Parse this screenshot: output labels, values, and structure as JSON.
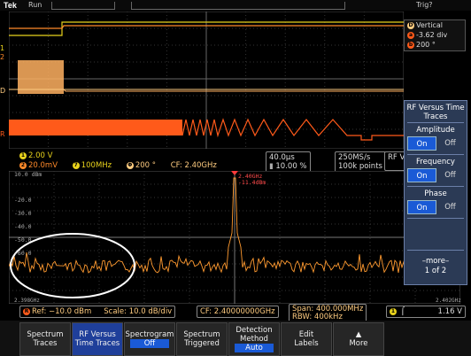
{
  "header": {
    "brand": "Tek",
    "run_state": "Run",
    "trigger_state": "Trig?"
  },
  "vertical_panel": {
    "title": "Vertical",
    "position": "-3.62 div",
    "angle": "200 °",
    "channel_label": "D"
  },
  "channel_markers": {
    "ch1": "1",
    "ch2": "2",
    "ch3": "3",
    "rf": "R"
  },
  "readouts": {
    "ch1_scale": "2.00 V",
    "ch2_scale": "20.0mV",
    "bw_label": "7",
    "bw": "100MHz",
    "phase_label": "Φ",
    "phase": "200 °",
    "cf_short": "CF: 2.40GHz",
    "timebase": "40.0µs",
    "duty": "10.00 %",
    "sample_rate": "250MS/s",
    "record_length": "100k points",
    "rf_label": "RF V"
  },
  "spectrum": {
    "top_scale": "10.0 dBm",
    "marker_freq": "2.40GHz",
    "marker_level": "-11.4dBm",
    "grid_labels": [
      "-20.0",
      "-30.0",
      "-40.0",
      "-50.0",
      "-60.0"
    ],
    "start_freq": "2.398GHz",
    "stop_freq": "2.402GHz"
  },
  "status": {
    "ref": "Ref: −10.0 dBm",
    "scale": "Scale: 10.0 dB/div",
    "cf": "CF: 2.40000000GHz",
    "span": "Span:   400.000MHz",
    "rbw": "RBW:   400kHz",
    "trig_ch": "1",
    "trig_slope": "⌠",
    "trig_level": "1.16 V"
  },
  "side_menu": {
    "title": "RF Versus Time Traces",
    "groups": [
      {
        "label": "Amplitude",
        "on": "On",
        "off": "Off"
      },
      {
        "label": "Frequency",
        "on": "On",
        "off": "Off"
      },
      {
        "label": "Phase",
        "on": "On",
        "off": "Off"
      }
    ],
    "more": "–more–",
    "page": "1 of 2"
  },
  "bottom_menu": [
    {
      "line1": "Spectrum",
      "line2": "Traces",
      "sub": ""
    },
    {
      "line1": "RF Versus",
      "line2": "Time Traces",
      "sub": ""
    },
    {
      "line1": "Spectrogram",
      "line2": "",
      "sub": "Off"
    },
    {
      "line1": "Spectrum",
      "line2": "Triggered",
      "sub": ""
    },
    {
      "line1": "Detection",
      "line2": "Method",
      "sub": "Auto"
    },
    {
      "line1": "Edit",
      "line2": "Labels",
      "sub": ""
    },
    {
      "line1": "▲",
      "line2": "More",
      "sub": ""
    }
  ],
  "colors": {
    "ch_yellow": "#e8d21c",
    "trace_orange": "#ff7a1a",
    "rf_orange": "#ff5a1a",
    "spectrum_orange": "#ff9a30",
    "accent_blue": "#1a5ad6"
  }
}
